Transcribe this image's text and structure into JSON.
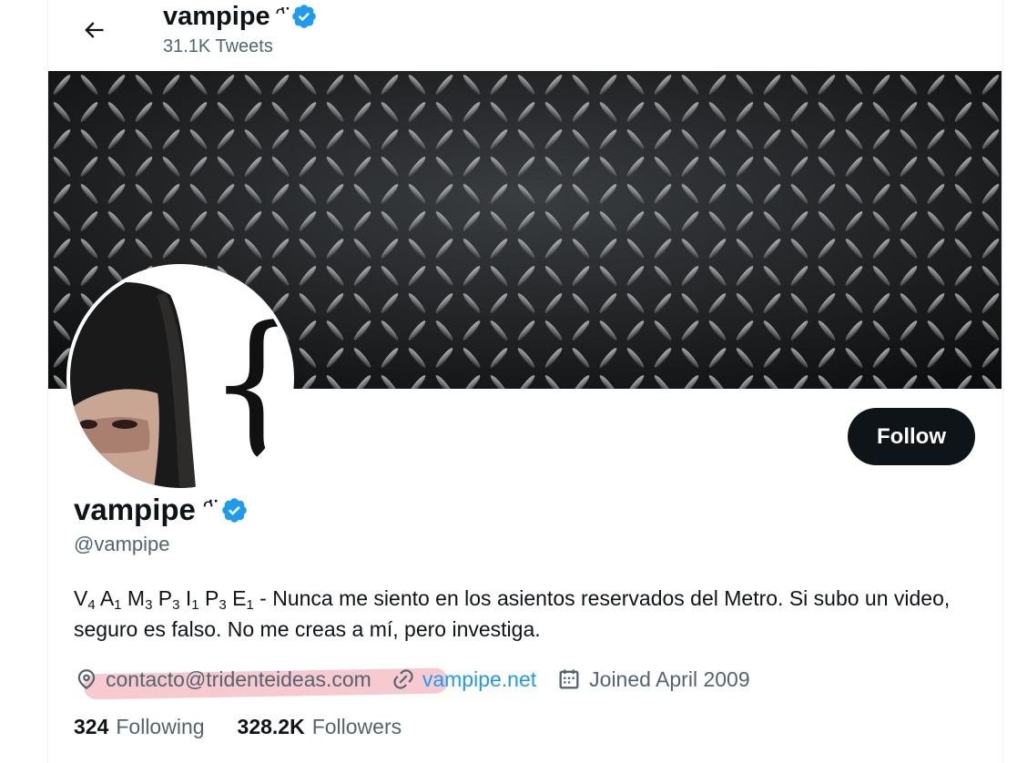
{
  "header": {
    "display_name": "vampipe",
    "emoticon": "ᵔ̈",
    "tweet_count": "31.1K Tweets"
  },
  "profile": {
    "display_name": "vampipe",
    "emoticon": "ᵔ̈",
    "handle": "@vampipe",
    "follow_label": "Follow",
    "bio_prefix": {
      "pairs": [
        {
          "letter": "V",
          "sub": "4"
        },
        {
          "letter": "A",
          "sub": "1"
        },
        {
          "letter": "M",
          "sub": "3"
        },
        {
          "letter": "P",
          "sub": "3"
        },
        {
          "letter": "I",
          "sub": "1"
        },
        {
          "letter": "P",
          "sub": "3"
        },
        {
          "letter": "E",
          "sub": "1"
        }
      ]
    },
    "bio_text": " - Nunca me siento en los asientos reservados del Metro. Si subo un video, seguro es falso. No me creas a mí, pero investiga.",
    "location": "contacto@tridenteideas.com",
    "website": "vampipe.net",
    "joined": "Joined April 2009",
    "following_count": "324",
    "following_label": "Following",
    "followers_count": "328.2K",
    "followers_label": "Followers"
  },
  "colors": {
    "accent": "#1d9bf0",
    "text": "#0f1419",
    "secondary": "#536471",
    "highlight": "#f3b8bf"
  },
  "icons": {
    "back": "arrow-left-icon",
    "verified": "verified-badge-icon",
    "location": "location-pin-icon",
    "link": "link-icon",
    "calendar": "calendar-icon"
  }
}
